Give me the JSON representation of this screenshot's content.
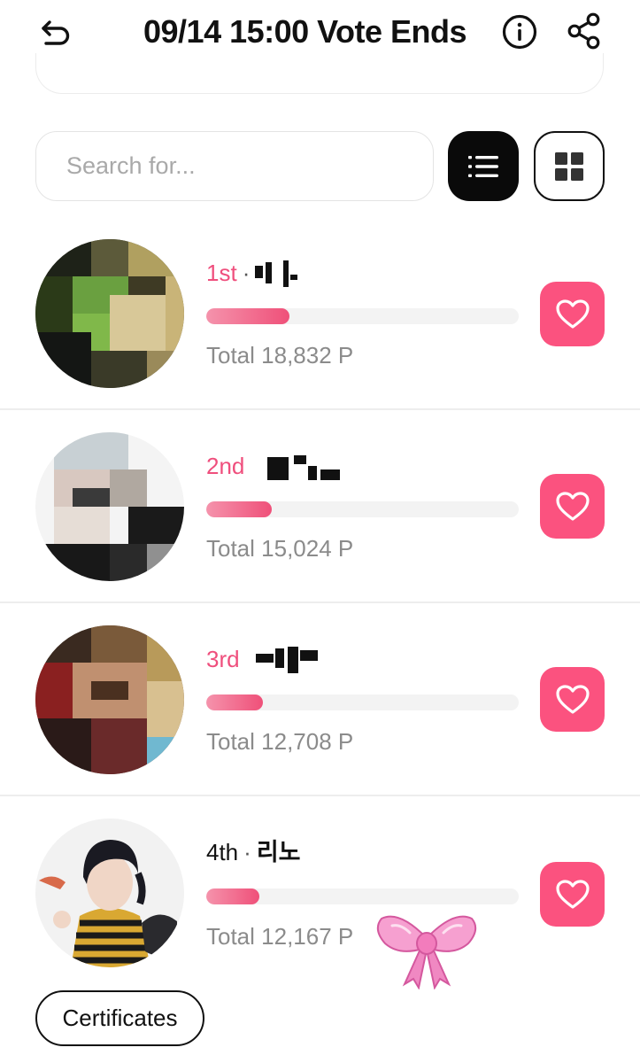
{
  "header": {
    "title": "09/14 15:00 Vote Ends",
    "back_icon": "back-arrow-icon",
    "info_icon": "info-circle-icon",
    "share_icon": "share-icon"
  },
  "search": {
    "placeholder": "Search for...",
    "value": ""
  },
  "view_toggle": {
    "list_icon": "list-view-icon",
    "grid_icon": "grid-view-icon",
    "active": "list"
  },
  "colors": {
    "accent": "#fb527f",
    "rank_pink": "#ef4f7d",
    "bar_start": "#f593ac",
    "bar_end": "#ef5079",
    "track": "#f3f3f3",
    "dark": "#0a0a0a"
  },
  "candidates": [
    {
      "rank": "1st",
      "separator": "·",
      "name": "",
      "total": "Total 18,832 P",
      "vote_share": 0.265
    },
    {
      "rank": "2nd",
      "separator": "",
      "name": "",
      "total": "Total 15,024 P",
      "vote_share": 0.21
    },
    {
      "rank": "3rd",
      "separator": "",
      "name": "",
      "total": "Total 12,708 P",
      "vote_share": 0.18
    },
    {
      "rank": "4th",
      "separator": "·",
      "name": "리노",
      "total": "Total 12,167 P",
      "vote_share": 0.17
    }
  ],
  "certificates_label": "Certificates"
}
